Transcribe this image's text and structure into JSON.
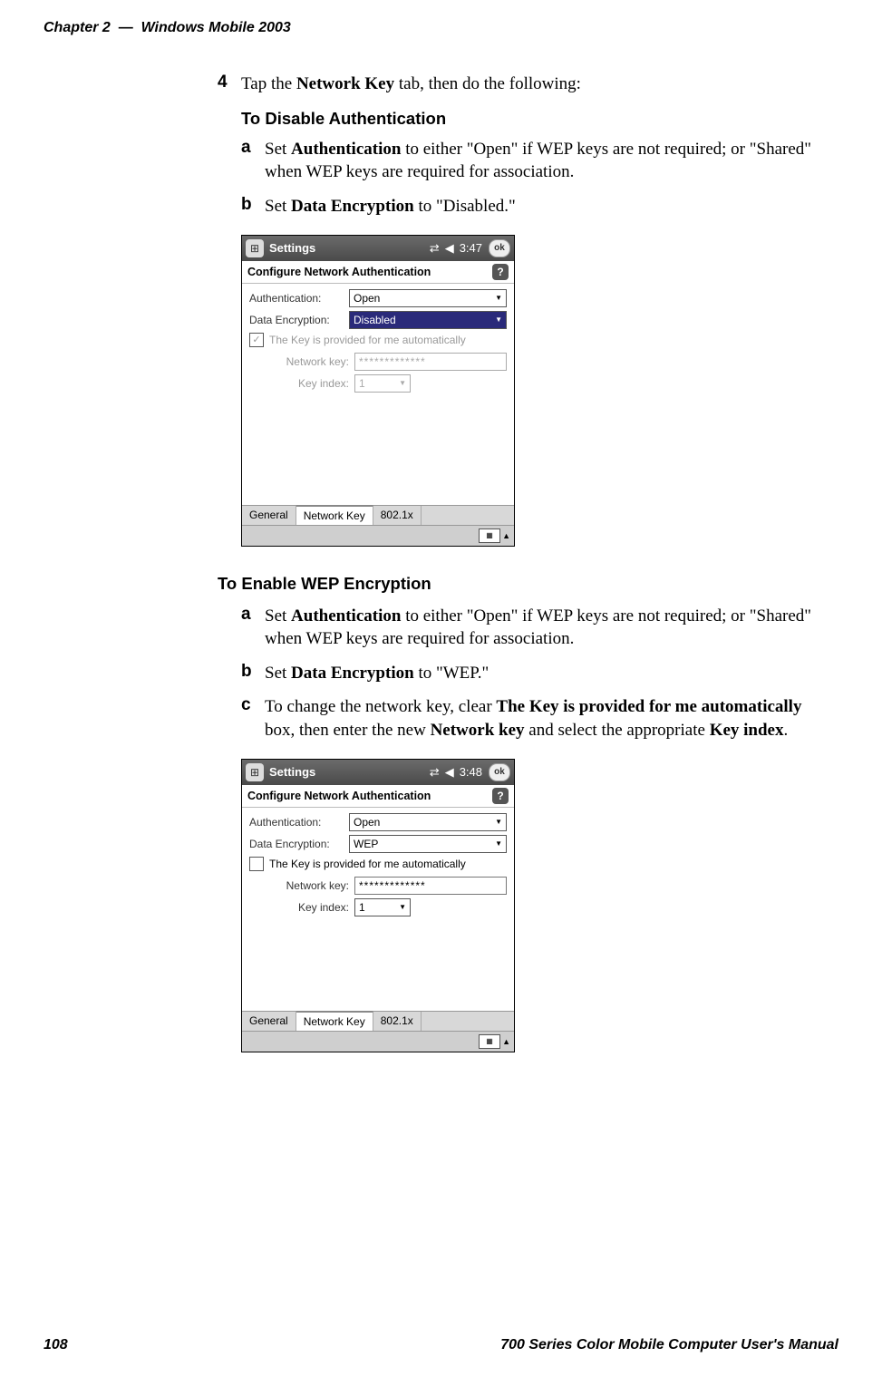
{
  "header": {
    "chapter_label": "Chapter 2",
    "sep": "—",
    "chapter_title": "Windows Mobile 2003"
  },
  "step4": {
    "num": "4",
    "text_before": "Tap the ",
    "bold1": "Network Key",
    "text_after": " tab, then do the following:"
  },
  "disable": {
    "heading": "To Disable Authentication",
    "a": {
      "letter": "a",
      "t1": "Set ",
      "b1": "Authentication",
      "t2": " to either \"Open\" if WEP keys are not required; or \"Shared\" when WEP keys are required for association."
    },
    "b": {
      "letter": "b",
      "t1": "Set ",
      "b1": "Data Encryption",
      "t2": " to \"Disabled.\""
    }
  },
  "enable": {
    "heading": "To Enable WEP Encryption",
    "a": {
      "letter": "a",
      "t1": "Set ",
      "b1": "Authentication",
      "t2": " to either \"Open\" if WEP keys are not required; or \"Shared\" when WEP keys are required for association."
    },
    "b": {
      "letter": "b",
      "t1": "Set ",
      "b1": "Data Encryption",
      "t2": " to \"WEP.\""
    },
    "c": {
      "letter": "c",
      "t1": "To change the network key, clear ",
      "b1": "The Key is provided for me automatically",
      "t2": " box, then enter the new ",
      "b2": "Network key",
      "t3": " and select the appropriate ",
      "b3": "Key index",
      "t4": "."
    }
  },
  "shot1": {
    "title": "Settings",
    "time": "3:47",
    "ok": "ok",
    "config_title": "Configure Network Authentication",
    "help": "?",
    "auth_label": "Authentication:",
    "auth_value": "Open",
    "enc_label": "Data Encryption:",
    "enc_value": "Disabled",
    "cb_label": "The Key is provided for me automatically",
    "netkey_label": "Network key:",
    "netkey_value": "*************",
    "keyidx_label": "Key index:",
    "keyidx_value": "1",
    "tabs": {
      "general": "General",
      "network_key": "Network Key",
      "dot1x": "802.1x"
    }
  },
  "shot2": {
    "title": "Settings",
    "time": "3:48",
    "ok": "ok",
    "config_title": "Configure Network Authentication",
    "help": "?",
    "auth_label": "Authentication:",
    "auth_value": "Open",
    "enc_label": "Data Encryption:",
    "enc_value": "WEP",
    "cb_label": "The Key is provided for me automatically",
    "netkey_label": "Network key:",
    "netkey_value": "*************",
    "keyidx_label": "Key index:",
    "keyidx_value": "1",
    "tabs": {
      "general": "General",
      "network_key": "Network Key",
      "dot1x": "802.1x"
    }
  },
  "footer": {
    "page": "108",
    "title": "700 Series Color Mobile Computer User's Manual"
  }
}
